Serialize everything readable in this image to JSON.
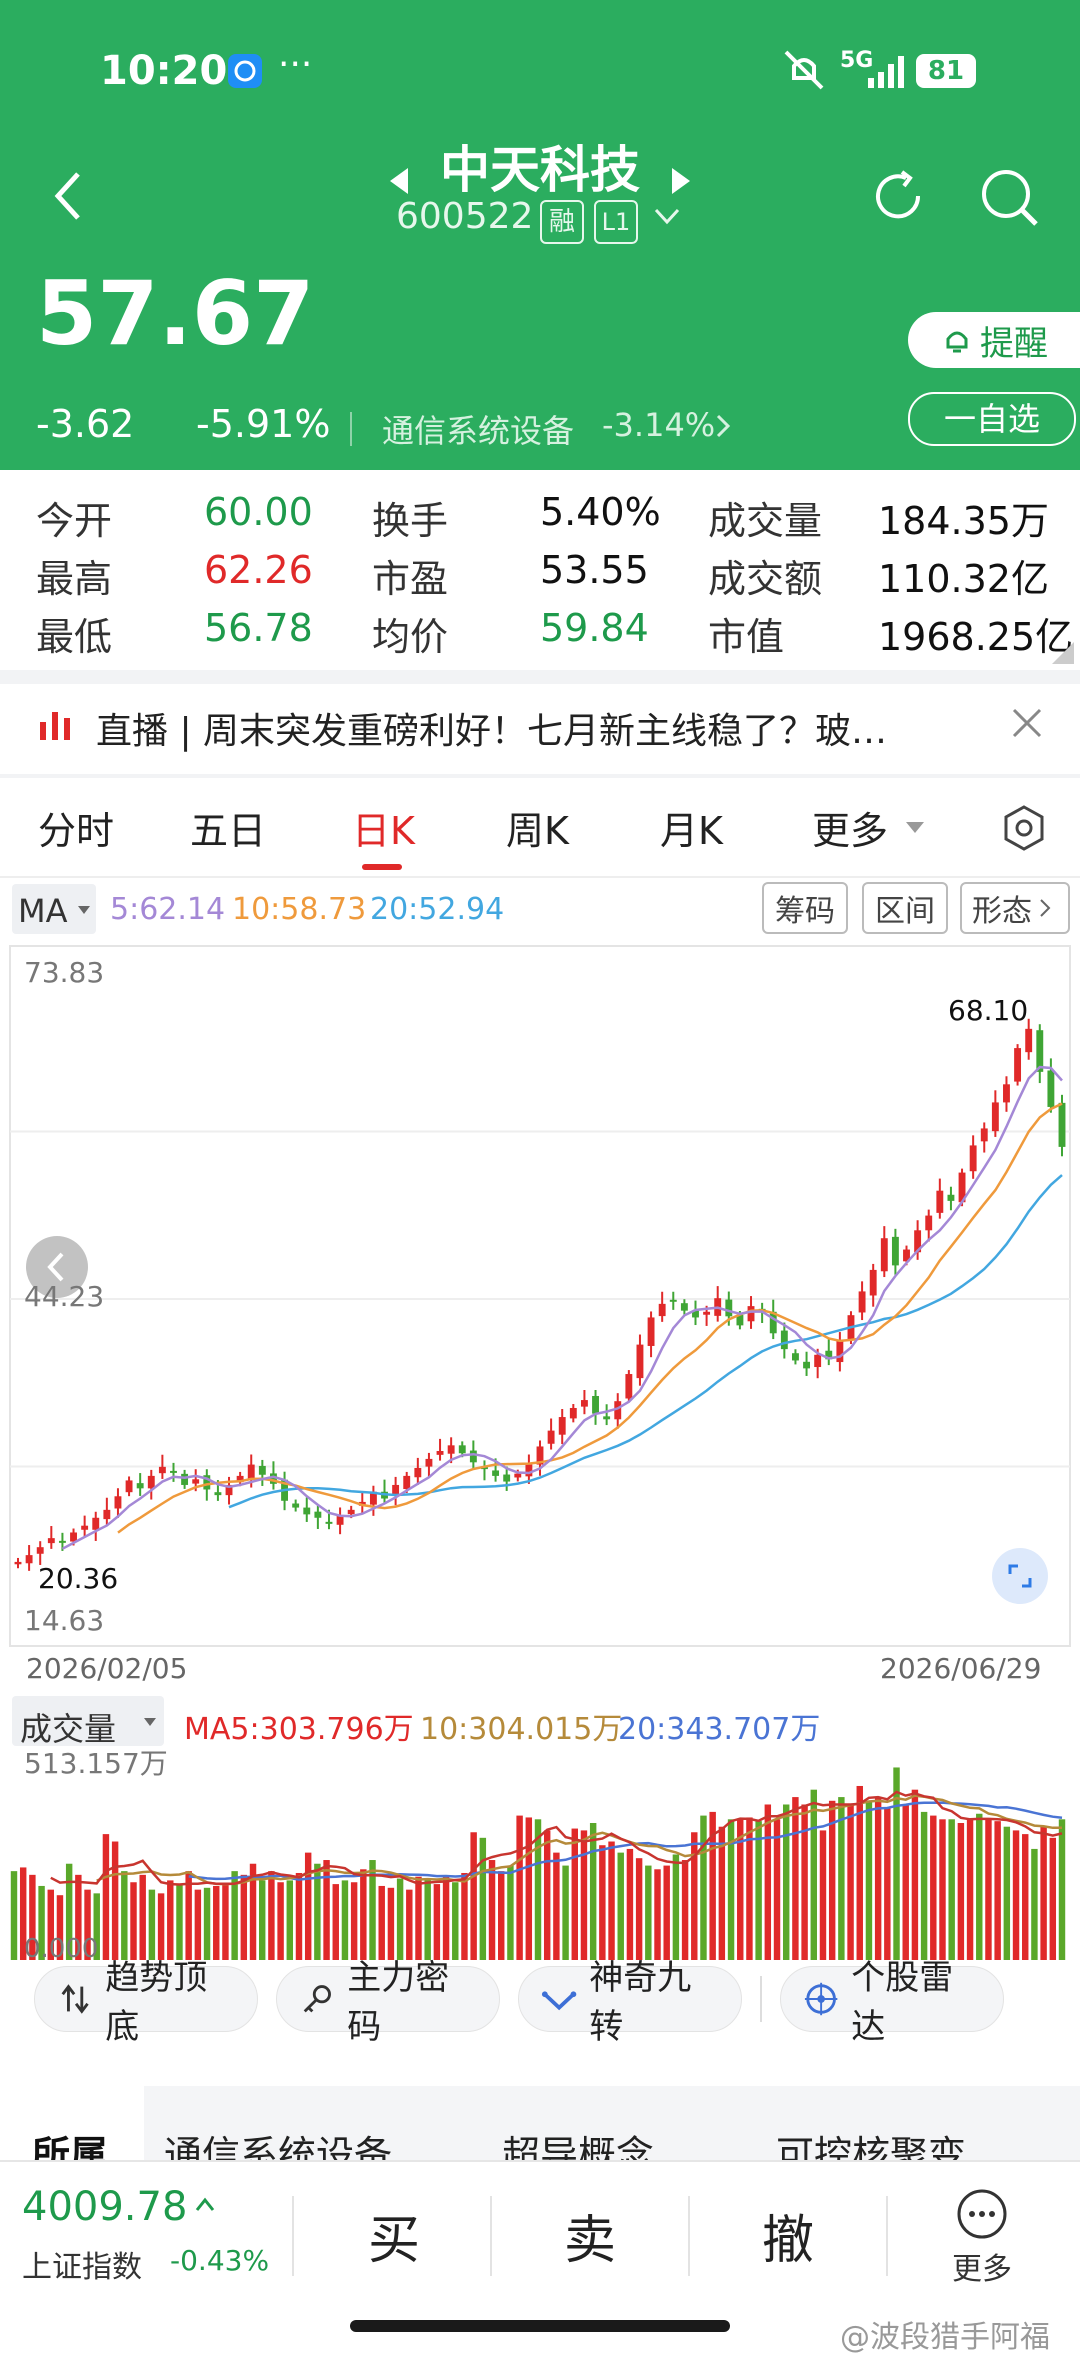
{
  "status_bar": {
    "time": "10:20",
    "network": "5G",
    "battery": "81"
  },
  "stock": {
    "name": "中天科技",
    "code": "600522",
    "tag_margin": "融",
    "tag_level": "L1",
    "price": "57.67",
    "change": "-3.62",
    "change_pct": "-5.91%",
    "sector_name": "通信系统设备",
    "sector_change": "-3.14%",
    "alert_label": "提醒",
    "watch_label": "一自选"
  },
  "stats": [
    {
      "label": "今开",
      "value": "60.00",
      "color": "green"
    },
    {
      "label": "换手",
      "value": "5.40%",
      "color": "normal"
    },
    {
      "label": "成交量",
      "value": "184.35万",
      "color": "normal"
    },
    {
      "label": "最高",
      "value": "62.26",
      "color": "red"
    },
    {
      "label": "市盈",
      "value": "53.55",
      "color": "normal"
    },
    {
      "label": "成交额",
      "value": "110.32亿",
      "color": "normal"
    },
    {
      "label": "最低",
      "value": "56.78",
      "color": "green"
    },
    {
      "label": "均价",
      "value": "59.84",
      "color": "green"
    },
    {
      "label": "市值",
      "value": "1968.25亿",
      "color": "normal"
    }
  ],
  "news": {
    "text": "直播 | 周末突发重磅利好！七月新主线稳了？玻…"
  },
  "tabs": [
    {
      "label": "分时"
    },
    {
      "label": "五日"
    },
    {
      "label": "日K"
    },
    {
      "label": "周K"
    },
    {
      "label": "月K"
    },
    {
      "label": "更多"
    }
  ],
  "ma_bar": {
    "selector": "MA",
    "ma5": "5:62.14",
    "ma10": "10:58.73",
    "ma20": "20:52.94",
    "btn1": "筹码",
    "btn2": "区间",
    "btn3": "形态"
  },
  "chart_labels": {
    "ymax": "73.83",
    "ymid": "44.23",
    "ymin": "14.63",
    "high_label": "68.10",
    "low_label": "20.36",
    "date_start": "2026/02/05",
    "date_end": "2026/06/29"
  },
  "volume_bar": {
    "selector": "成交量",
    "ma5": "MA5:303.796万",
    "ma10": "10:304.015万",
    "ma20": "20:343.707万",
    "vmax": "513.157万",
    "vmin": "0.000"
  },
  "chart_data": {
    "type": "candlestick",
    "price_range": [
      14.63,
      73.83
    ],
    "close": [
      21.0,
      21.6,
      22.3,
      23.1,
      22.8,
      23.6,
      24.2,
      24.9,
      25.6,
      26.8,
      28.2,
      27.5,
      28.6,
      29.4,
      28.9,
      27.8,
      28.3,
      27.4,
      26.9,
      27.8,
      28.6,
      29.6,
      28.7,
      27.9,
      26.4,
      25.8,
      25.2,
      24.9,
      24.4,
      25.1,
      25.6,
      26.3,
      27.2,
      26.6,
      27.8,
      28.6,
      29.3,
      30.1,
      30.8,
      31.3,
      30.6,
      29.8,
      29.2,
      28.6,
      28.1,
      28.8,
      29.6,
      31.2,
      32.6,
      33.8,
      34.6,
      35.3,
      34.1,
      33.6,
      35.2,
      37.6,
      40.2,
      42.6,
      43.8,
      44.1,
      43.2,
      42.6,
      43.1,
      44.3,
      42.7,
      41.9,
      43.6,
      43.1,
      41.2,
      39.8,
      38.8,
      38.1,
      39.3,
      38.9,
      40.6,
      42.8,
      44.9,
      46.8,
      49.6,
      47.2,
      48.6,
      50.3,
      51.6,
      53.8,
      52.9,
      55.4,
      57.8,
      59.3,
      61.6,
      63.2,
      66.4,
      68.1,
      64.3,
      61.2,
      57.67
    ],
    "volume_wan": [
      240,
      250,
      230,
      200,
      190,
      175,
      260,
      230,
      190,
      180,
      340,
      320,
      240,
      210,
      230,
      190,
      180,
      215,
      205,
      240,
      190,
      195,
      200,
      205,
      240,
      230,
      260,
      215,
      240,
      210,
      215,
      235,
      290,
      260,
      270,
      205,
      215,
      210,
      245,
      270,
      200,
      195,
      220,
      190,
      225,
      215,
      205,
      225,
      210,
      235,
      345,
      330,
      270,
      240,
      255,
      390,
      385,
      380,
      350,
      290,
      255,
      355,
      350,
      370,
      310,
      320,
      290,
      300,
      275,
      255,
      245,
      255,
      285,
      270,
      345,
      390,
      400,
      360,
      380,
      380,
      385,
      375,
      420,
      380,
      420,
      440,
      420,
      460,
      350,
      430,
      440,
      420,
      470,
      430,
      440,
      410,
      520,
      420,
      460,
      400,
      390,
      380,
      380,
      370,
      380,
      395,
      380,
      375,
      360,
      350,
      340,
      300,
      360,
      330,
      380
    ]
  },
  "tools": [
    {
      "label": "趋势顶底"
    },
    {
      "label": "主力密码"
    },
    {
      "label": "神奇九转"
    },
    {
      "label": "个股雷达"
    }
  ],
  "related": {
    "label": "所属",
    "items": [
      "通信系统设备",
      "超导概念",
      "可控核聚变"
    ]
  },
  "bottom": {
    "index_value": "4009.78",
    "index_name": "上证指数",
    "index_change": "-0.43%",
    "buy": "买",
    "sell": "卖",
    "cancel": "撤",
    "more": "更多"
  },
  "watermark": "@波段猎手阿福",
  "colors": {
    "header_green": "#2bad5f",
    "up_red": "#e02929",
    "down_green": "#1e9a4b",
    "ma5": "#a488d6",
    "ma10": "#ef9a3c",
    "ma20": "#42a7e0"
  }
}
